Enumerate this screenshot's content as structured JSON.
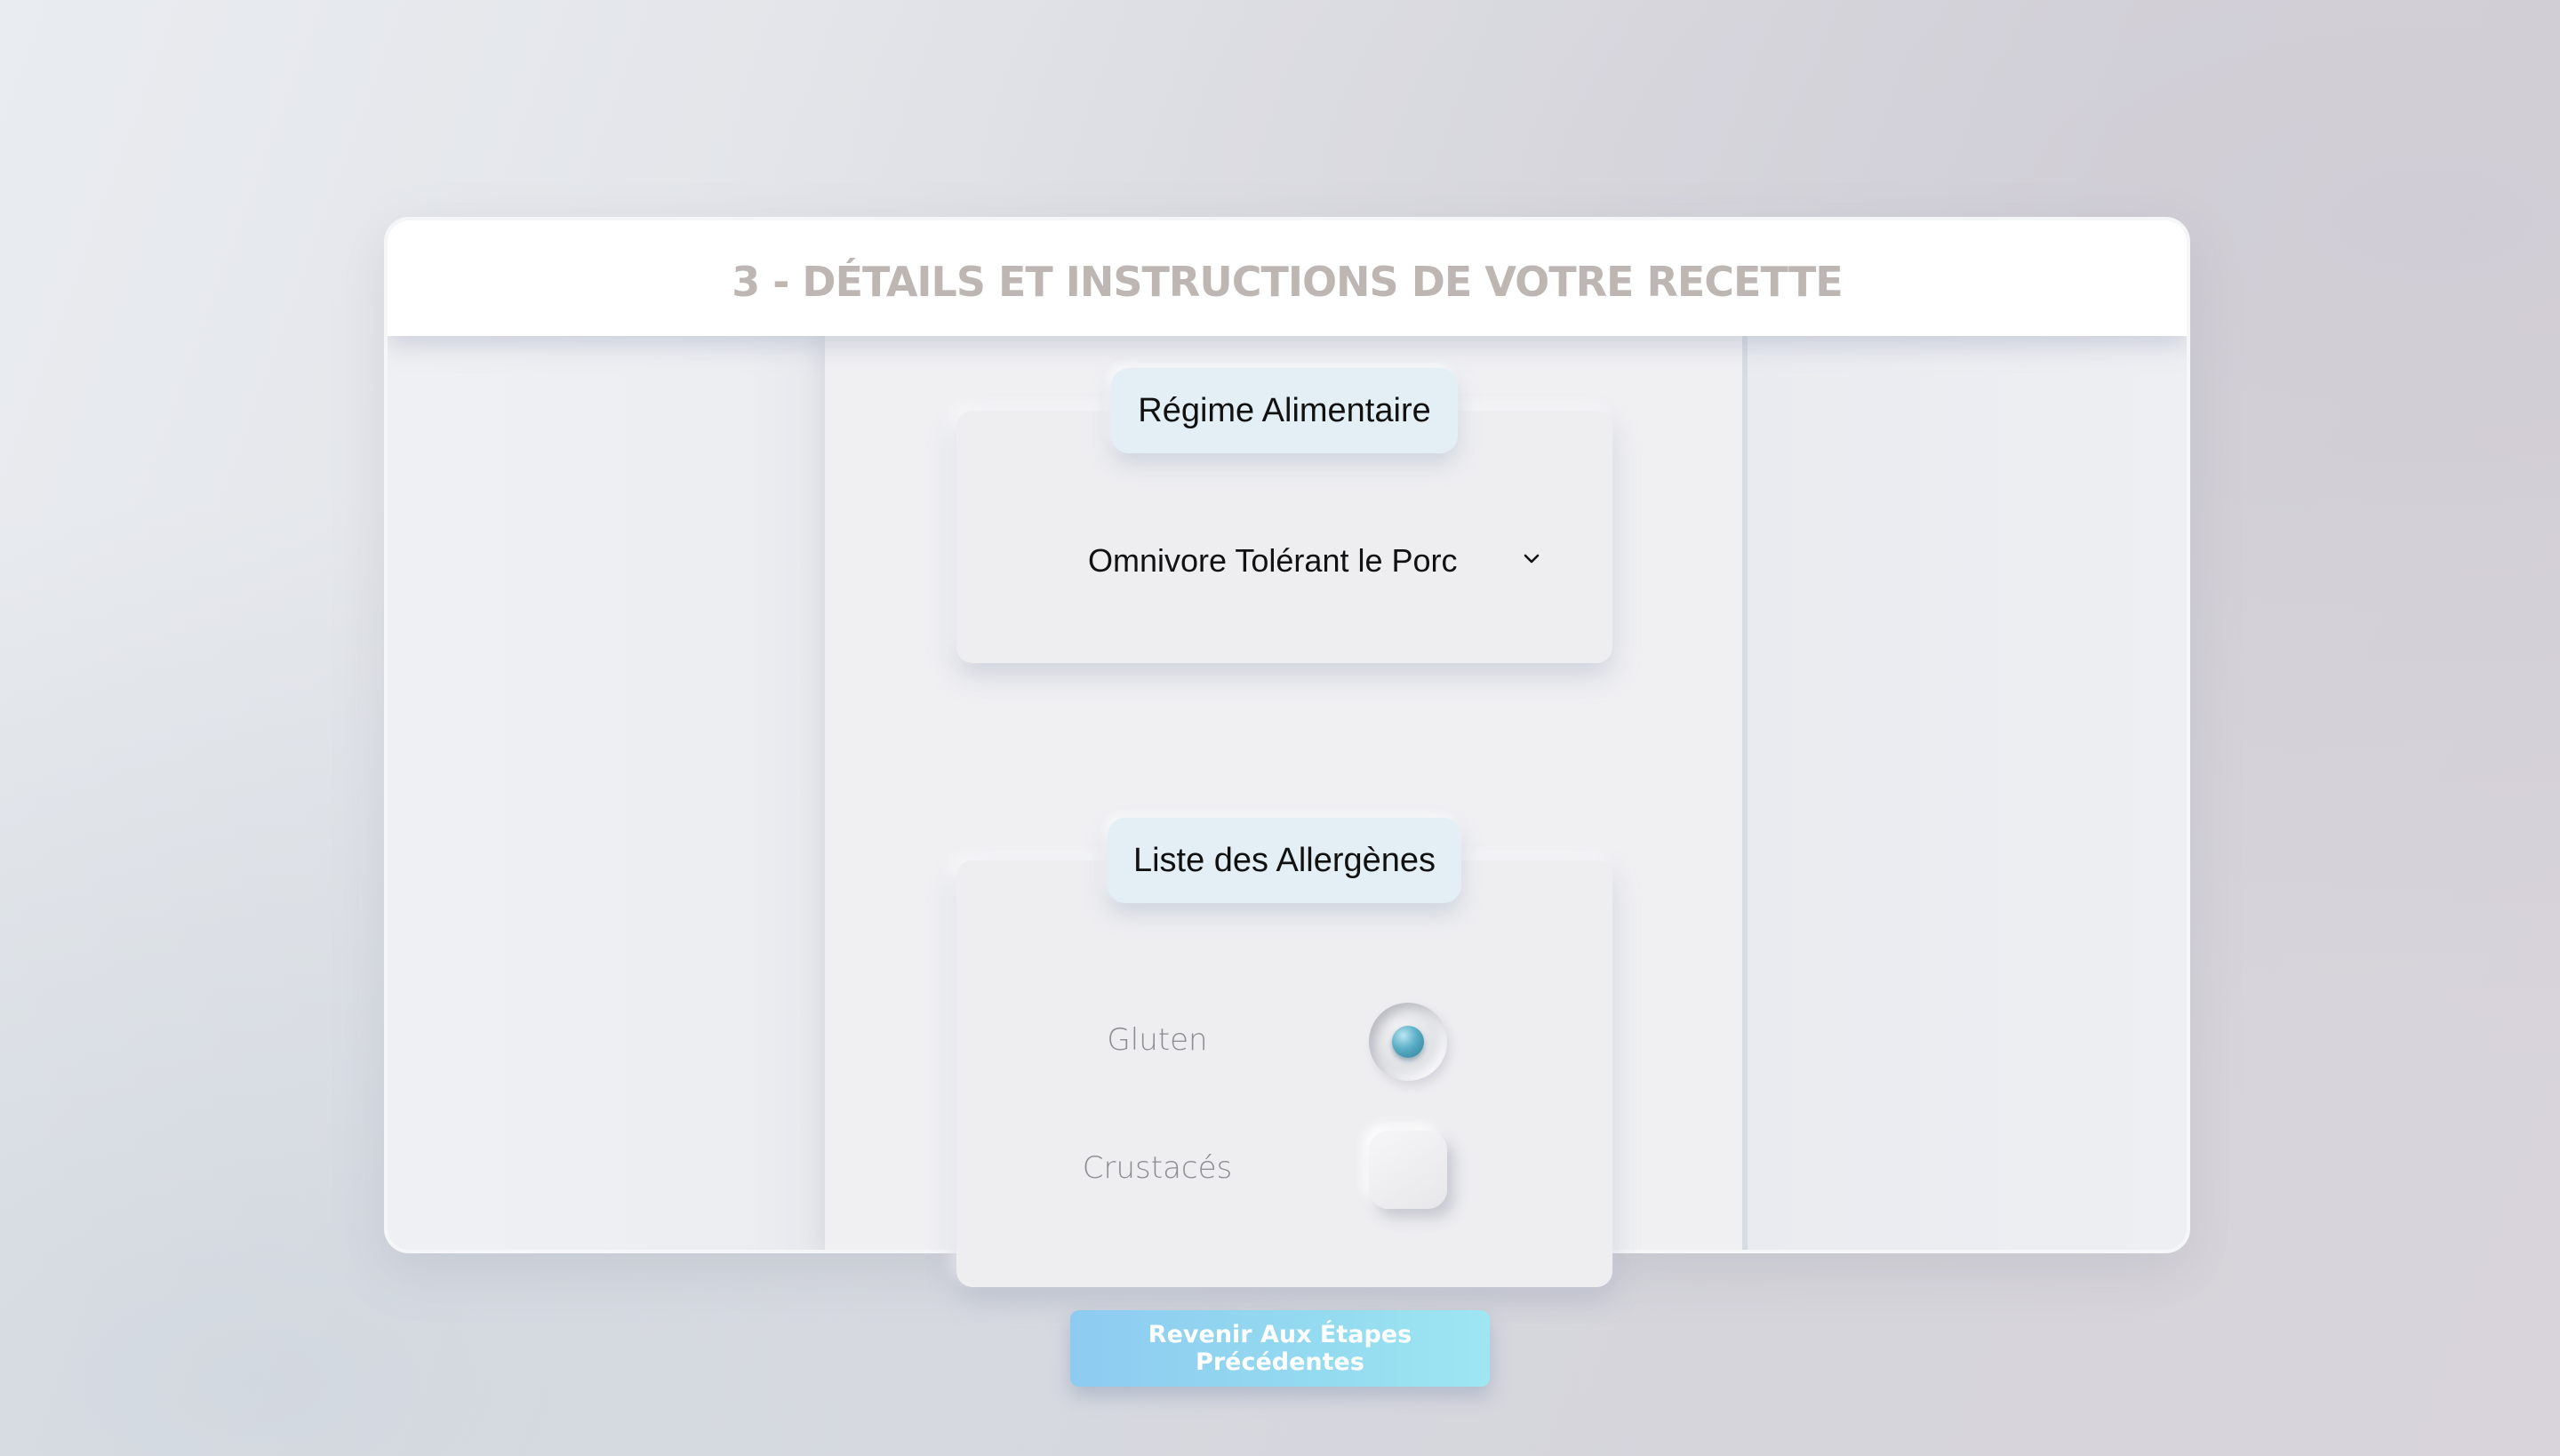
{
  "header": {
    "title": "3 - DÉTAILS ET INSTRUCTIONS DE VOTRE RECETTE"
  },
  "diet_section": {
    "tab_label": "Régime Alimentaire",
    "select_value": "Omnivore Tolérant le Porc",
    "select_icon": "chevron-down-icon"
  },
  "allergens_section": {
    "tab_label": "Liste des Allergènes",
    "items": [
      {
        "label": "Gluten",
        "checked": true
      },
      {
        "label": "Crustacés",
        "checked": false
      }
    ]
  },
  "footer": {
    "back_button_label": "Revenir Aux Étapes Précédentes"
  },
  "colors": {
    "title": "#bdb6b3",
    "tab_background": "#e3eff4",
    "toggle_active": "#5aaec6",
    "button_gradient_start": "#8ecbf1",
    "button_gradient_end": "#9ee6f2"
  }
}
